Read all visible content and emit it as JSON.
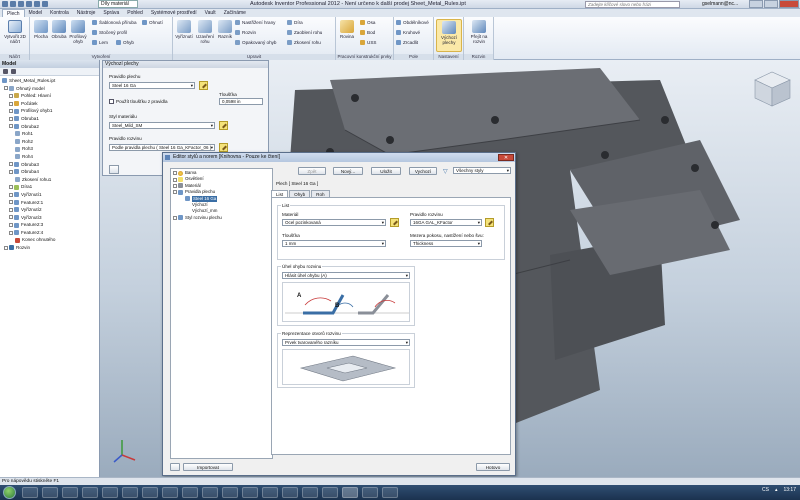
{
  "title_bar": {
    "app_title": "Autodesk Inventor Professional 2012 - Není určeno k další prodej   Sheet_Metal_Rules.ipt",
    "document_dropdown": "Díly materiál",
    "help_search_placeholder": "Zadejte klíčové slovo nebo frázi",
    "user": "gselmann@nc..."
  },
  "ribbon_tabs": [
    "Plech",
    "Model",
    "Kontrola",
    "Nástroje",
    "Správa",
    "Pohled",
    "Systémové prostředí",
    "Vault",
    "Začínáme"
  ],
  "ribbon": {
    "sketch_group": {
      "title": "Náčrt",
      "create_2d_sketch": "Vytvořit 2D náčrt"
    },
    "create_group": {
      "title": "Vytvoření",
      "face": "Plocha",
      "contour_flange": "Obruba",
      "contour_roll": "Profilový ohyb",
      "lofted_flange": "Šablonová příruba",
      "roll": "Stočený profil",
      "flange": "Lem",
      "bend": "Ohyb",
      "fold": "Ohnutí"
    },
    "modify_group": {
      "title": "Upravit",
      "cut": "Vyříznutí",
      "corner_round": "Uzavření rohu",
      "punch": "Razník",
      "corner_seam": "Nastřižení hrany",
      "corner_round2": "Rozvin",
      "repeat_bend": "Opakovaný ohyb",
      "hole": "Díra",
      "fillet": "Zaoblení rohu",
      "chamfer": "Zkosení rohu"
    },
    "work_group": {
      "title": "Pracovní konstrukční prvky",
      "plane": "Rovina",
      "axis": "Osa",
      "point": "Bod",
      "ucs": "USS"
    },
    "pattern_group": {
      "title": "Pole",
      "rectangular": "Obdélníkové",
      "circular": "Kruhové",
      "mirror": "Zrcadlit"
    },
    "setup_group": {
      "title": "Nastavení",
      "sheet_metal_defaults": "Výchozí plechy"
    },
    "flat_group": {
      "title": "Rozvin",
      "go_to_flat": "Přejít na rozvin"
    }
  },
  "browser": {
    "header": "Model",
    "items": [
      "Sheet_Metal_Rules.ipt",
      "Ohnutý model",
      "Pohled: Hlavní",
      "Počátek",
      "Profilový ohyb1",
      "Obruba1",
      "Obruba2",
      "Roh1",
      "Roh2",
      "Roh3",
      "Roh4",
      "Obruba3",
      "Obruba4",
      "Zkosení rohu1",
      "Díra1",
      "Vyříznutí1",
      "Feature2:1",
      "Vyříznutí2",
      "Vyříznutí3",
      "Feature2:3",
      "Feature2:4",
      "Konec ohnutého",
      "Rozvin"
    ]
  },
  "defaults_panel": {
    "title": "Výchozí plechy",
    "sheet_rule_label": "Pravidlo plechu",
    "sheet_rule_value": "Steel 16 Ga",
    "use_thickness_label": "Použít tloušťku z pravidla",
    "thickness_label": "Tloušťka",
    "thickness_value": "0,0598 in",
    "material_label": "Styl materiálu",
    "material_value": "Steel_Mild_SM",
    "unfold_rule_label": "Pravidlo rozvinu",
    "unfold_rule_value": "Podle pravidla plechu ( Steel 16 Ga_KFactor_06 )"
  },
  "style_editor": {
    "title": "Editor stylů a norem [Knihovna - Pouze ke čtení]",
    "tree": [
      "Barva",
      "Osvětlení",
      "Materiál",
      "Pravidla plechu",
      "Steel 16 Ga",
      "Výchozí",
      "Výchozí_mm",
      "Styl rozvinu plechu"
    ],
    "buttons": {
      "back": "Zpět",
      "new": "Nový...",
      "save": "Uložit",
      "reset": "Vychozí",
      "import": "Importovat",
      "done": "Hotovo"
    },
    "filter_value": "Všechny styly",
    "section_title": "Plech [ Steel 16 Ga ]",
    "tabs": [
      "List",
      "Ohyb",
      "Roh"
    ],
    "sheet_group": {
      "legend": "List",
      "material_label": "Materiál",
      "material_value": "Ocel pozinkovaná",
      "thickness_label": "Tloušťka",
      "thickness_value": "1 mm",
      "unfold_rule_label": "Pravidlo rozvinu",
      "unfold_rule_value": "16GA GAL_KFactor",
      "gap_label": "Mezera pokosu, nastížení nebo švu:",
      "gap_value": "Thickness"
    },
    "bend_angle_group": {
      "legend": "Úhel ohybu rozvinu",
      "value": "Hlásit úhel ohybu (A)",
      "label_a": "A",
      "label_b": "B"
    },
    "punch_group": {
      "legend": "Reprezentace otvorů rozvinu",
      "value": "Prvek tvarovaného razníku"
    }
  },
  "status_bar": {
    "text": "Pro nápovědu stiskněte F1"
  },
  "taskbar": {
    "language": "CS",
    "time": "13:17"
  },
  "colors": {
    "accent": "#3a6ea5",
    "model_gray": "#5f6166",
    "close_red": "#c84a3a"
  }
}
